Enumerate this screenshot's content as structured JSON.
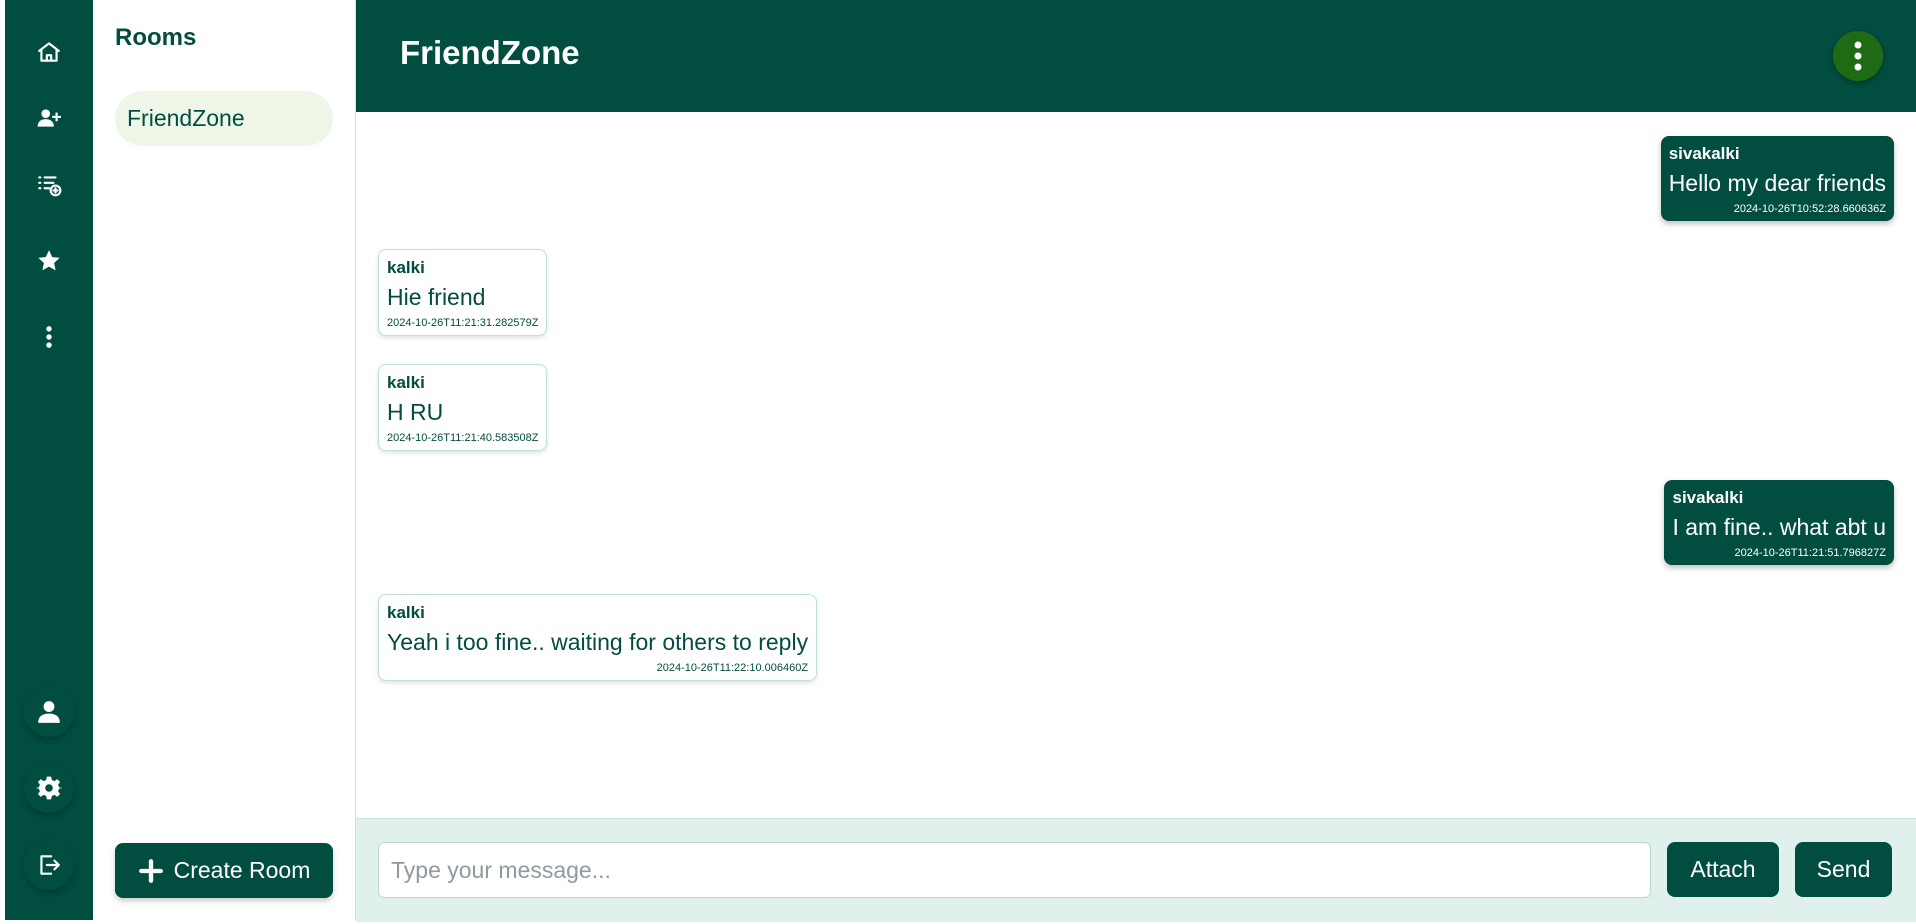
{
  "rail": {
    "icons": [
      "home-icon",
      "add-user-icon",
      "add-list-icon",
      "star-icon",
      "more-vertical-icon",
      "user-icon",
      "gear-icon",
      "logout-icon"
    ]
  },
  "rooms": {
    "title": "Rooms",
    "items": [
      {
        "label": "FriendZone"
      }
    ],
    "create_label": "Create Room"
  },
  "chat": {
    "title": "FriendZone",
    "messages": [
      {
        "sender": "sivakalki",
        "text": "Hello my dear friends",
        "time": "2024-10-26T10:52:28.660636Z",
        "mine": true
      },
      {
        "sender": "kalki",
        "text": "Hie friend",
        "time": "2024-10-26T11:21:31.282579Z",
        "mine": false
      },
      {
        "sender": "kalki",
        "text": "H RU",
        "time": "2024-10-26T11:21:40.583508Z",
        "mine": false
      },
      {
        "sender": "sivakalki",
        "text": "I am fine.. what abt u",
        "time": "2024-10-26T11:21:51.796827Z",
        "mine": true
      },
      {
        "sender": "kalki",
        "text": "Yeah i too fine.. waiting for others to reply",
        "time": "2024-10-26T11:22:10.006460Z",
        "mine": false
      }
    ]
  },
  "composer": {
    "placeholder": "Type your message...",
    "value": "",
    "attach_label": "Attach",
    "send_label": "Send"
  },
  "colors": {
    "primary": "#014d40",
    "room_active_bg": "#eef6e8",
    "composer_bg": "#e0f0ed",
    "menu_button": "#1f6b14"
  }
}
